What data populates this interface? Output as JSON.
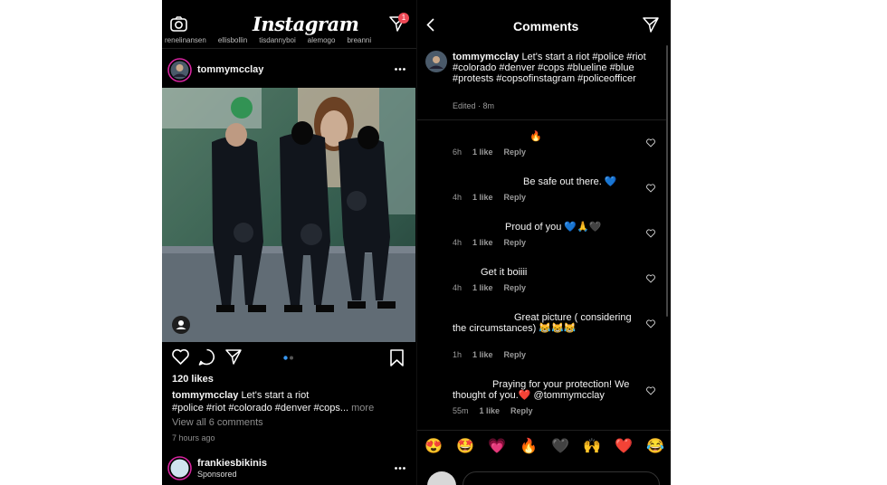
{
  "feed": {
    "app_name": "Instagram",
    "notification_count": "1",
    "stories": [
      "renelinansen",
      "ellisbollin",
      "tisdannyboi",
      "alemogo",
      "breanni"
    ],
    "post": {
      "username": "tommymcclay",
      "likes": "120 likes",
      "caption_user": "tommymcclay",
      "caption_text": "Let's start a riot",
      "caption_tags": "#police #riot #colorado #denver #cops...",
      "more_label": "more",
      "view_comments": "View all 6 comments",
      "time": "7 hours ago"
    },
    "next_post": {
      "username": "frankiesbikinis",
      "sponsored": "Sponsored"
    }
  },
  "comments_screen": {
    "title": "Comments",
    "original": {
      "username": "tommymcclay",
      "text": "Let's start a riot",
      "tags": "#police #riot #colorado #denver #cops #blueline #blue #protests #copsofinstagram #policeofficer",
      "meta": "Edited · 8m"
    },
    "comments": [
      {
        "text": "🔥",
        "time": "6h",
        "likes": "1 like",
        "reply": "Reply"
      },
      {
        "text": "Be safe out there. 💙",
        "time": "4h",
        "likes": "1 like",
        "reply": "Reply"
      },
      {
        "text": "Proud of you 💙🙏🖤",
        "time": "4h",
        "likes": "1 like",
        "reply": "Reply"
      },
      {
        "text": "Get it boiiii",
        "time": "4h",
        "likes": "1 like",
        "reply": "Reply"
      },
      {
        "text": "Great picture ( considering the circumstances) 😹😹😹",
        "time": "1h",
        "likes": "1 like",
        "reply": "Reply"
      },
      {
        "text": "Praying for your protection! We thought of you.❤️ @tommymcclay",
        "time": "55m",
        "likes": "1 like",
        "reply": "Reply"
      }
    ],
    "emoji_bar": [
      "😍",
      "🤩",
      "💗",
      "🔥",
      "🖤",
      "🙌",
      "❤️",
      "😂"
    ]
  },
  "colors": {
    "background": "#000000",
    "badge": "#ed4956",
    "heart_red": "#e0245e",
    "muted_text": "#8e8e8e",
    "dots_active": "#3897f0"
  },
  "icons": [
    "camera-icon",
    "send-icon",
    "more-icon",
    "heart-icon",
    "comment-icon",
    "bookmark-icon",
    "back-icon",
    "user-tag-icon"
  ]
}
